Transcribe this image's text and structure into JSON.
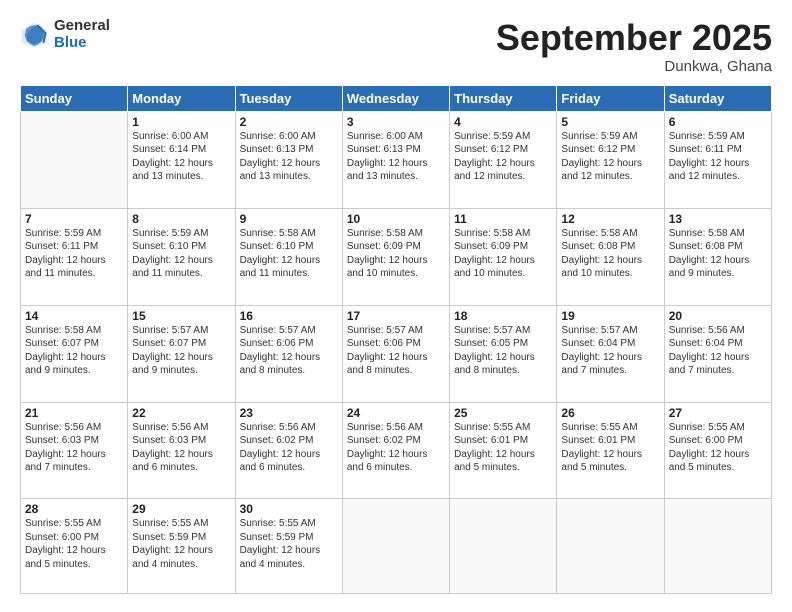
{
  "logo": {
    "general": "General",
    "blue": "Blue"
  },
  "title": "September 2025",
  "location": "Dunkwa, Ghana",
  "days_header": [
    "Sunday",
    "Monday",
    "Tuesday",
    "Wednesday",
    "Thursday",
    "Friday",
    "Saturday"
  ],
  "weeks": [
    [
      {
        "day": "",
        "info": ""
      },
      {
        "day": "1",
        "info": "Sunrise: 6:00 AM\nSunset: 6:14 PM\nDaylight: 12 hours\nand 13 minutes."
      },
      {
        "day": "2",
        "info": "Sunrise: 6:00 AM\nSunset: 6:13 PM\nDaylight: 12 hours\nand 13 minutes."
      },
      {
        "day": "3",
        "info": "Sunrise: 6:00 AM\nSunset: 6:13 PM\nDaylight: 12 hours\nand 13 minutes."
      },
      {
        "day": "4",
        "info": "Sunrise: 5:59 AM\nSunset: 6:12 PM\nDaylight: 12 hours\nand 12 minutes."
      },
      {
        "day": "5",
        "info": "Sunrise: 5:59 AM\nSunset: 6:12 PM\nDaylight: 12 hours\nand 12 minutes."
      },
      {
        "day": "6",
        "info": "Sunrise: 5:59 AM\nSunset: 6:11 PM\nDaylight: 12 hours\nand 12 minutes."
      }
    ],
    [
      {
        "day": "7",
        "info": "Sunrise: 5:59 AM\nSunset: 6:11 PM\nDaylight: 12 hours\nand 11 minutes."
      },
      {
        "day": "8",
        "info": "Sunrise: 5:59 AM\nSunset: 6:10 PM\nDaylight: 12 hours\nand 11 minutes."
      },
      {
        "day": "9",
        "info": "Sunrise: 5:58 AM\nSunset: 6:10 PM\nDaylight: 12 hours\nand 11 minutes."
      },
      {
        "day": "10",
        "info": "Sunrise: 5:58 AM\nSunset: 6:09 PM\nDaylight: 12 hours\nand 10 minutes."
      },
      {
        "day": "11",
        "info": "Sunrise: 5:58 AM\nSunset: 6:09 PM\nDaylight: 12 hours\nand 10 minutes."
      },
      {
        "day": "12",
        "info": "Sunrise: 5:58 AM\nSunset: 6:08 PM\nDaylight: 12 hours\nand 10 minutes."
      },
      {
        "day": "13",
        "info": "Sunrise: 5:58 AM\nSunset: 6:08 PM\nDaylight: 12 hours\nand 9 minutes."
      }
    ],
    [
      {
        "day": "14",
        "info": "Sunrise: 5:58 AM\nSunset: 6:07 PM\nDaylight: 12 hours\nand 9 minutes."
      },
      {
        "day": "15",
        "info": "Sunrise: 5:57 AM\nSunset: 6:07 PM\nDaylight: 12 hours\nand 9 minutes."
      },
      {
        "day": "16",
        "info": "Sunrise: 5:57 AM\nSunset: 6:06 PM\nDaylight: 12 hours\nand 8 minutes."
      },
      {
        "day": "17",
        "info": "Sunrise: 5:57 AM\nSunset: 6:06 PM\nDaylight: 12 hours\nand 8 minutes."
      },
      {
        "day": "18",
        "info": "Sunrise: 5:57 AM\nSunset: 6:05 PM\nDaylight: 12 hours\nand 8 minutes."
      },
      {
        "day": "19",
        "info": "Sunrise: 5:57 AM\nSunset: 6:04 PM\nDaylight: 12 hours\nand 7 minutes."
      },
      {
        "day": "20",
        "info": "Sunrise: 5:56 AM\nSunset: 6:04 PM\nDaylight: 12 hours\nand 7 minutes."
      }
    ],
    [
      {
        "day": "21",
        "info": "Sunrise: 5:56 AM\nSunset: 6:03 PM\nDaylight: 12 hours\nand 7 minutes."
      },
      {
        "day": "22",
        "info": "Sunrise: 5:56 AM\nSunset: 6:03 PM\nDaylight: 12 hours\nand 6 minutes."
      },
      {
        "day": "23",
        "info": "Sunrise: 5:56 AM\nSunset: 6:02 PM\nDaylight: 12 hours\nand 6 minutes."
      },
      {
        "day": "24",
        "info": "Sunrise: 5:56 AM\nSunset: 6:02 PM\nDaylight: 12 hours\nand 6 minutes."
      },
      {
        "day": "25",
        "info": "Sunrise: 5:55 AM\nSunset: 6:01 PM\nDaylight: 12 hours\nand 5 minutes."
      },
      {
        "day": "26",
        "info": "Sunrise: 5:55 AM\nSunset: 6:01 PM\nDaylight: 12 hours\nand 5 minutes."
      },
      {
        "day": "27",
        "info": "Sunrise: 5:55 AM\nSunset: 6:00 PM\nDaylight: 12 hours\nand 5 minutes."
      }
    ],
    [
      {
        "day": "28",
        "info": "Sunrise: 5:55 AM\nSunset: 6:00 PM\nDaylight: 12 hours\nand 5 minutes."
      },
      {
        "day": "29",
        "info": "Sunrise: 5:55 AM\nSunset: 5:59 PM\nDaylight: 12 hours\nand 4 minutes."
      },
      {
        "day": "30",
        "info": "Sunrise: 5:55 AM\nSunset: 5:59 PM\nDaylight: 12 hours\nand 4 minutes."
      },
      {
        "day": "",
        "info": ""
      },
      {
        "day": "",
        "info": ""
      },
      {
        "day": "",
        "info": ""
      },
      {
        "day": "",
        "info": ""
      }
    ]
  ]
}
